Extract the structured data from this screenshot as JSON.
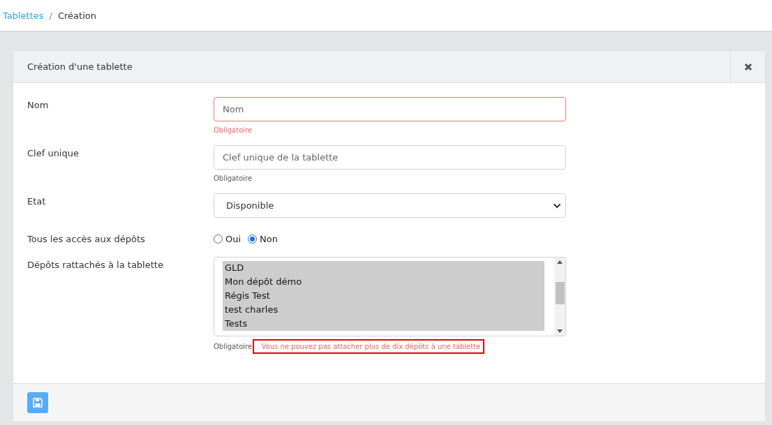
{
  "breadcrumb": [
    {
      "label": "Tablettes",
      "link": true
    },
    {
      "label": "Création",
      "link": false
    }
  ],
  "breadcrumb_separator": "/",
  "card": {
    "title": "Création d'une tablette"
  },
  "fields": [
    {
      "kind": "text",
      "label": "Nom",
      "placeholder": "Nom",
      "invalid": true,
      "help": "Obligatoire"
    },
    {
      "kind": "text",
      "label": "Clef unique",
      "placeholder": "Clef unique de la tablette",
      "invalid": false,
      "help": "Obligatoire"
    },
    {
      "kind": "select",
      "label": "Etat",
      "value": "Disponible"
    },
    {
      "kind": "radio",
      "label": "Tous les accès aux dépôts",
      "options": [
        {
          "label": "Oui",
          "selected": false
        },
        {
          "label": "Non",
          "selected": true
        }
      ]
    },
    {
      "kind": "list",
      "label": "Dépôts rattachés à la tablette",
      "items": [
        {
          "label": "GLD",
          "selected": true
        },
        {
          "label": "Mon dépôt démo",
          "selected": true
        },
        {
          "label": "Régis Test",
          "selected": true
        },
        {
          "label": "test charles",
          "selected": true
        },
        {
          "label": "Tests",
          "selected": true
        }
      ],
      "help": "Obligatoire",
      "error": ". Vous ne pouvez pas attacher plus de dix dépôts à une tablette"
    }
  ]
}
